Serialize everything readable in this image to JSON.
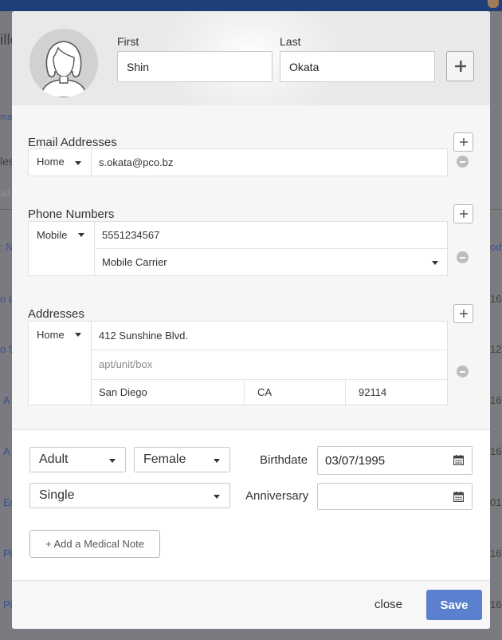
{
  "background": {
    "fragments": [
      {
        "id": "f1",
        "text": "ille"
      },
      {
        "id": "f2",
        "text": "ma"
      },
      {
        "id": "f3",
        "text": "les"
      },
      {
        "id": "f4",
        "text": "ail"
      },
      {
        "id": "f5",
        "text": ": N"
      },
      {
        "id": "f6",
        "text": "o Li"
      },
      {
        "id": "f7",
        "text": "o S"
      },
      {
        "id": "f8",
        "text": "A"
      },
      {
        "id": "f9",
        "text": "A"
      },
      {
        "id": "f10",
        "text": "Er"
      },
      {
        "id": "f11",
        "text": "Pi"
      },
      {
        "id": "f12",
        "text": "Pi"
      },
      {
        "id": "r1",
        "text": "oda"
      },
      {
        "id": "r2",
        "text": "16"
      },
      {
        "id": "r3",
        "text": "12"
      },
      {
        "id": "r4",
        "text": "16"
      },
      {
        "id": "r5",
        "text": "16"
      },
      {
        "id": "r6",
        "text": "01"
      },
      {
        "id": "r7",
        "text": "16"
      },
      {
        "id": "r8",
        "text": "16"
      }
    ]
  },
  "header": {
    "avatar_icon": "person-silhouette-icon",
    "first_label": "First",
    "first_value": "Shin",
    "last_label": "Last",
    "last_value": "Okata",
    "add_name_icon": "plus-icon"
  },
  "email": {
    "title": "Email Addresses",
    "type": "Home",
    "value": "s.okata@pco.bz"
  },
  "phone": {
    "title": "Phone Numbers",
    "type": "Mobile",
    "value": "5551234567",
    "carrier": "Mobile Carrier"
  },
  "address": {
    "title": "Addresses",
    "type": "Home",
    "street": "412 Sunshine Blvd.",
    "street2_placeholder": "apt/unit/box",
    "city": "San Diego",
    "state": "CA",
    "zip": "92114"
  },
  "details": {
    "age_group": "Adult",
    "gender": "Female",
    "marital": "Single",
    "birthdate_label": "Birthdate",
    "birthdate": "03/07/1995",
    "anniversary_label": "Anniversary",
    "anniversary": "",
    "medical_button": "+ Add a Medical Note"
  },
  "footer": {
    "close_label": "close",
    "save_label": "Save"
  },
  "colors": {
    "primary": "#5b80cf",
    "topbar": "#1f3f7a"
  }
}
